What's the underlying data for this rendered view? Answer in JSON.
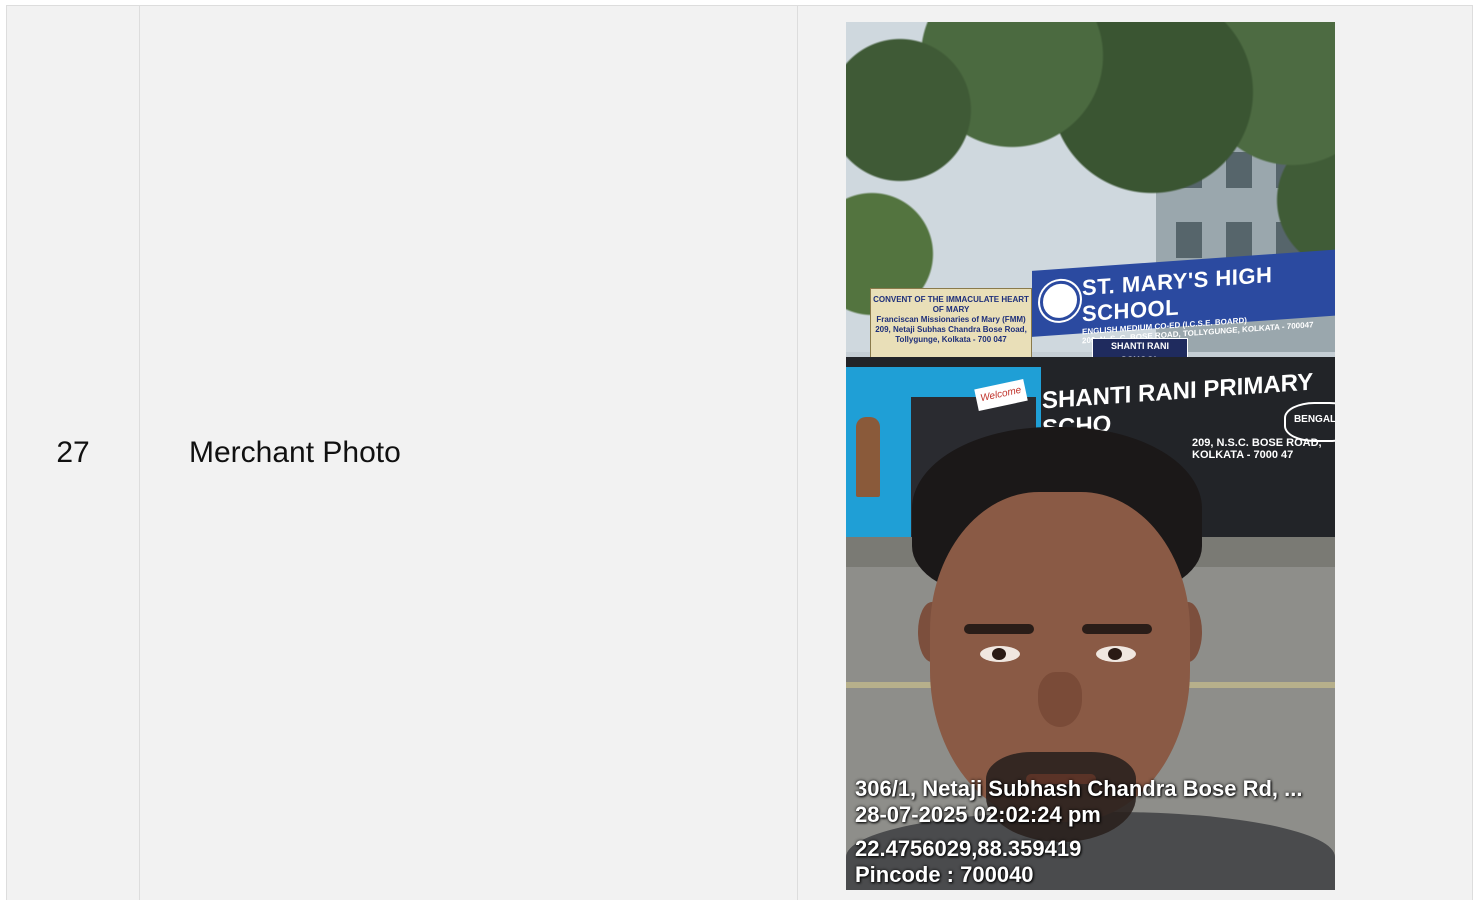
{
  "row": {
    "index": "27",
    "label": "Merchant Photo"
  },
  "photo": {
    "signs": {
      "convent_line1": "CONVENT OF THE IMMACULATE HEART OF MARY",
      "convent_line2": "Franciscan Missionaries of Mary (FMM)",
      "convent_line3": "209, Netaji Subhas Chandra Bose Road,",
      "convent_line4": "Tollygunge, Kolkata - 700 047",
      "school_title": "ST. MARY'S HIGH SCHOOL",
      "school_sub1": "ENGLISH MEDIUM CO-ED (I.C.S.E. BOARD)",
      "school_sub2": "209, N. S. C. BOSE ROAD, TOLLYGUNGE, KOLKATA - 700047",
      "shanti_small": "SHANTI RANI SCHOOL",
      "welcome": "Welcome",
      "primary_title": "SHANTI RANI PRIMARY SCHO",
      "primary_addr1": "209, N.S.C. BOSE ROAD,",
      "primary_addr2": "KOLKATA - 7000 47",
      "badge": "BENGALI M"
    },
    "overlay": {
      "address": "306/1, Netaji Subhash Chandra Bose Rd, ...",
      "datetime": "28-07-2025 02:02:24 pm",
      "coords": "22.4756029,88.359419",
      "pincode": "Pincode : 700040"
    }
  }
}
